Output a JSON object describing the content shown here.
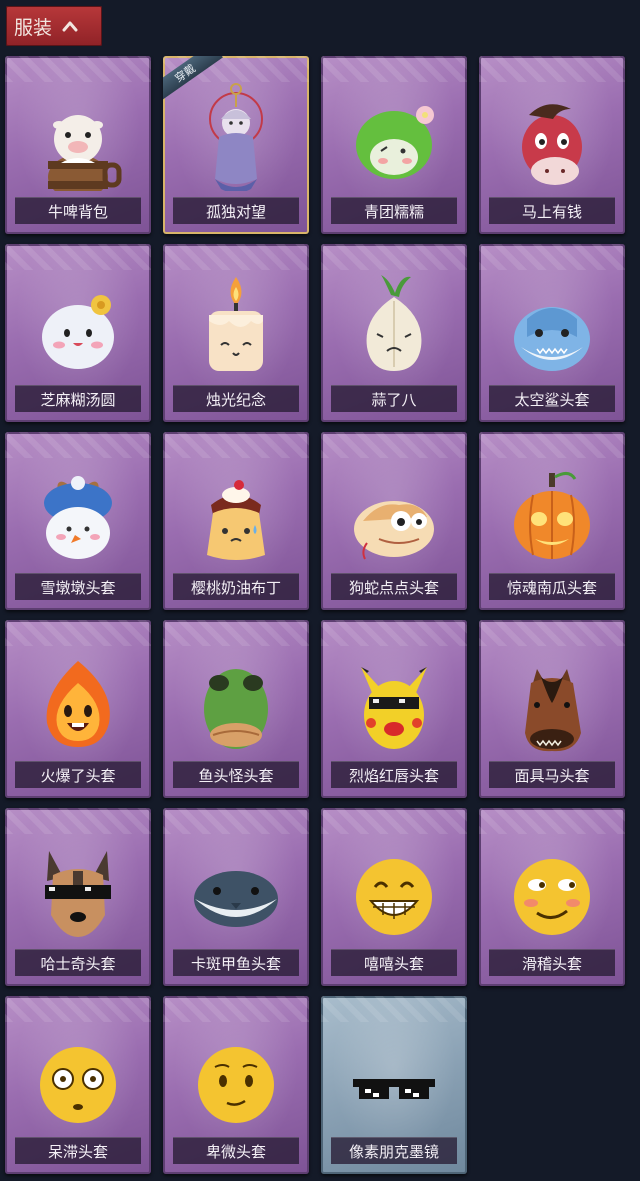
{
  "header": {
    "title": "服装",
    "toggle_icon": "chevron-up-icon"
  },
  "items": [
    {
      "name": "牛啤背包",
      "icon": "cow-beer-barrel-icon",
      "style": "normal",
      "equipped": false
    },
    {
      "name": "孤独对望",
      "icon": "figure-keychain-icon",
      "style": "normal",
      "equipped": true
    },
    {
      "name": "青团糯糯",
      "icon": "green-dumpling-icon",
      "style": "normal",
      "equipped": false
    },
    {
      "name": "马上有钱",
      "icon": "red-horse-icon",
      "style": "normal",
      "equipped": false
    },
    {
      "name": "芝麻糊汤圆",
      "icon": "white-rice-ball-icon",
      "style": "normal",
      "equipped": false
    },
    {
      "name": "烛光纪念",
      "icon": "candle-icon",
      "style": "normal",
      "equipped": false
    },
    {
      "name": "蒜了八",
      "icon": "garlic-icon",
      "style": "normal",
      "equipped": false
    },
    {
      "name": "太空鲨头套",
      "icon": "shark-head-icon",
      "style": "normal",
      "equipped": false
    },
    {
      "name": "雪墩墩头套",
      "icon": "snowman-head-icon",
      "style": "normal",
      "equipped": false
    },
    {
      "name": "樱桃奶油布丁",
      "icon": "pudding-icon",
      "style": "normal",
      "equipped": false
    },
    {
      "name": "狗蛇点点头套",
      "icon": "snake-head-icon",
      "style": "normal",
      "equipped": false
    },
    {
      "name": "惊魂南瓜头套",
      "icon": "pumpkin-head-icon",
      "style": "normal",
      "equipped": false
    },
    {
      "name": "火爆了头套",
      "icon": "fire-head-icon",
      "style": "normal",
      "equipped": false
    },
    {
      "name": "鱼头怪头套",
      "icon": "fish-head-icon",
      "style": "normal",
      "equipped": false
    },
    {
      "name": "烈焰红唇头套",
      "icon": "pikachu-mask-icon",
      "style": "normal",
      "equipped": false
    },
    {
      "name": "面具马头套",
      "icon": "horse-mask-icon",
      "style": "normal",
      "equipped": false
    },
    {
      "name": "哈士奇头套",
      "icon": "husky-head-icon",
      "style": "normal",
      "equipped": false
    },
    {
      "name": "卡斑甲鱼头套",
      "icon": "whale-head-icon",
      "style": "normal",
      "equipped": false
    },
    {
      "name": "嘻嘻头套",
      "icon": "grin-emoji-icon",
      "style": "normal",
      "equipped": false
    },
    {
      "name": "滑稽头套",
      "icon": "funny-emoji-icon",
      "style": "normal",
      "equipped": false
    },
    {
      "name": "呆滞头套",
      "icon": "dazed-emoji-icon",
      "style": "normal",
      "equipped": false
    },
    {
      "name": "卑微头套",
      "icon": "humble-emoji-icon",
      "style": "normal",
      "equipped": false
    },
    {
      "name": "像素朋克墨镜",
      "icon": "pixel-sunglasses-icon",
      "style": "gray",
      "equipped": false
    }
  ],
  "equipped_badge": "穿戴"
}
